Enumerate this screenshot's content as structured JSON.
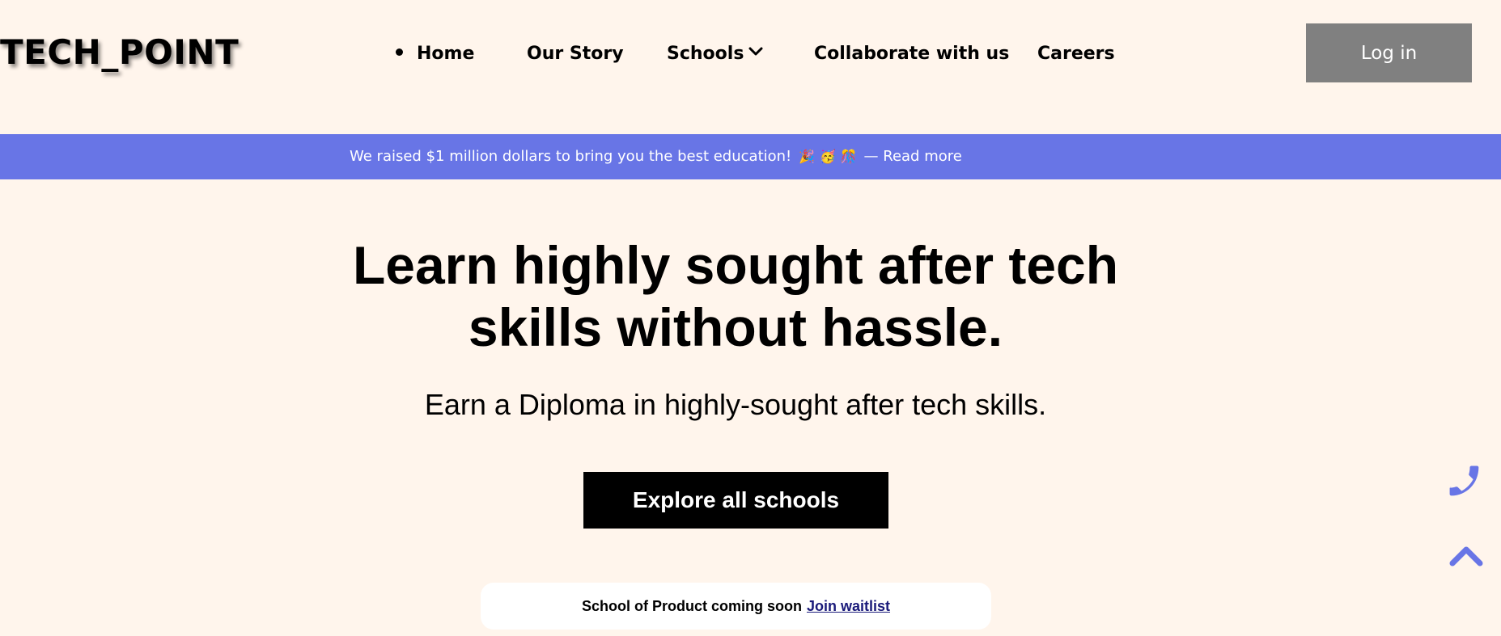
{
  "brand": {
    "logo": "TECH_POINT"
  },
  "nav": {
    "items": [
      {
        "label": "Home",
        "active": true
      },
      {
        "label": "Our Story"
      },
      {
        "label": "Schools",
        "has_dropdown": true
      },
      {
        "label": "Collaborate with us"
      },
      {
        "label": "Careers"
      }
    ],
    "login_label": "Log in"
  },
  "announcement": {
    "text": "We raised $1 million dollars to bring you the best education!",
    "emojis": [
      "🎉",
      "🥳",
      "🎊"
    ],
    "separator": "—",
    "link_label": "Read more"
  },
  "hero": {
    "title_line1": "Learn highly sought after tech",
    "title_line2": "skills without hassle.",
    "subtitle": "Earn a Diploma in highly-sought after tech skills.",
    "cta_label": "Explore all schools"
  },
  "notice": {
    "text": "School of Product coming soon",
    "link_label": "Join waitlist"
  },
  "floating": {
    "icons": [
      "phone-icon",
      "chevron-up-icon"
    ],
    "accent_color": "#6875e6"
  },
  "colors": {
    "background": "#fff5ec",
    "announcement_bg": "#6875e6",
    "login_bg": "#808080",
    "cta_bg": "#000000"
  }
}
